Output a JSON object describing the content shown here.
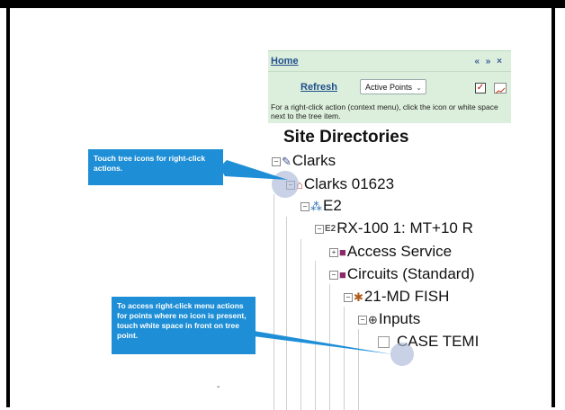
{
  "panel": {
    "home_label": "Home",
    "nav_icons": "« » ×",
    "refresh_label": "Refresh",
    "select_value": "Active Points",
    "help_text": "For a right-click action (context menu), click the icon or white space next to the tree item."
  },
  "tree": {
    "title": "Site Directories",
    "items": [
      {
        "label": "Clarks",
        "expander": "−",
        "icon": "site-group-icon"
      },
      {
        "label": "Clarks 01623",
        "expander": "−",
        "icon": "site-icon"
      },
      {
        "label": "E2",
        "expander": "−",
        "icon": "network-icon"
      },
      {
        "label": "RX-100 1: MT+10 R",
        "expander": "−",
        "icon": "e2-controller-icon"
      },
      {
        "label": "Access Service",
        "expander": "+",
        "icon": "folder-icon"
      },
      {
        "label": "Circuits (Standard)",
        "expander": "−",
        "icon": "folder-icon"
      },
      {
        "label": "21-MD FISH",
        "expander": "−",
        "icon": "circuit-icon"
      },
      {
        "label": "Inputs",
        "expander": "−",
        "icon": "inputs-icon"
      },
      {
        "label": "CASE TEMI",
        "expander": "",
        "icon": "point-box-icon"
      }
    ]
  },
  "callouts": {
    "top": "Touch tree icons for right-click actions.",
    "bottom": "To access right-click menu actions for points where no icon is present, touch white space in front on tree point."
  },
  "footer_mark": "-",
  "colors": {
    "callout": "#1e8fd6",
    "panel_header": "#dcefdc",
    "link": "#1f4e8c",
    "touch_circle": "#aab9d7"
  }
}
